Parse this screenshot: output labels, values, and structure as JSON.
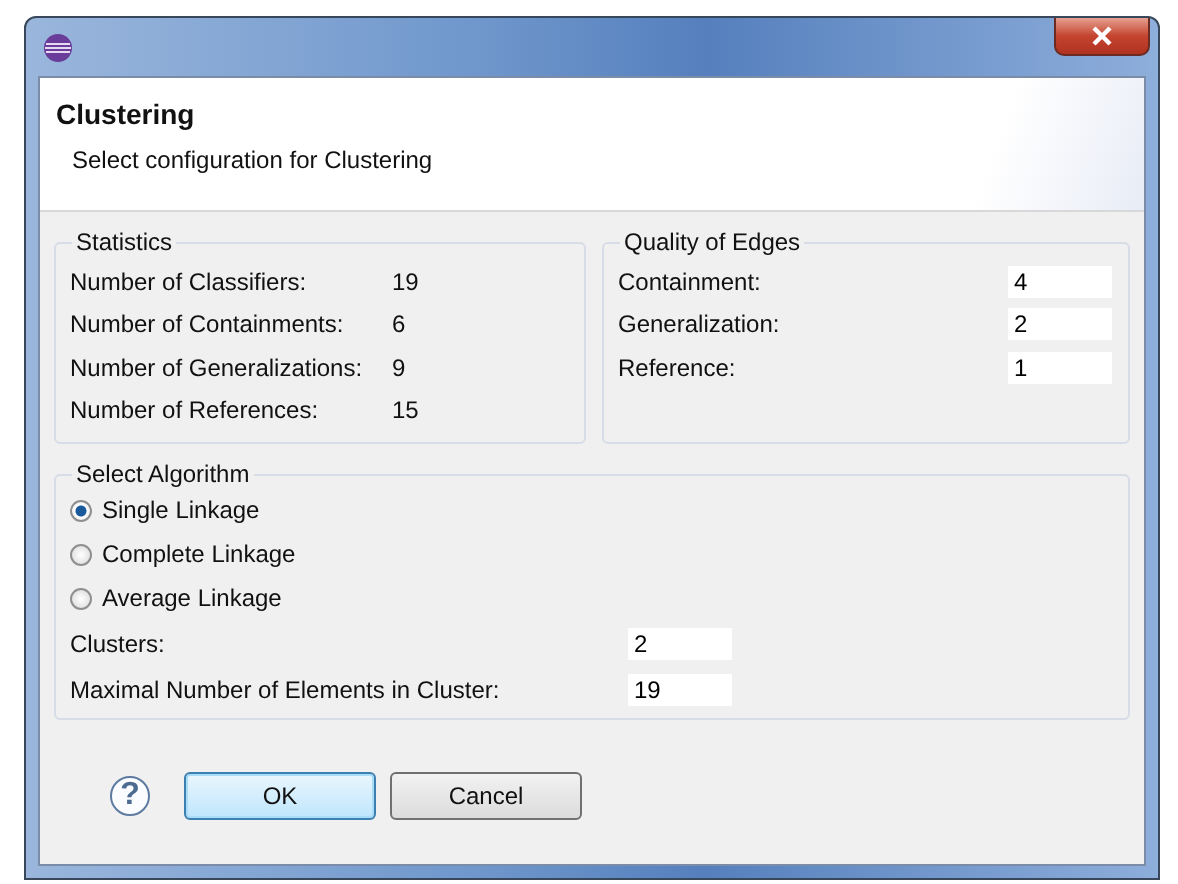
{
  "header": {
    "title": "Clustering",
    "description": "Select configuration for Clustering"
  },
  "statistics": {
    "title": "Statistics",
    "rows": [
      {
        "label": "Number of Classifiers:",
        "value": "19"
      },
      {
        "label": "Number of Containments:",
        "value": "6"
      },
      {
        "label": "Number of Generalizations:",
        "value": "9"
      },
      {
        "label": "Number of References:",
        "value": "15"
      }
    ]
  },
  "quality_of_edges": {
    "title": "Quality of Edges",
    "fields": [
      {
        "label": "Containment:",
        "value": "4"
      },
      {
        "label": "Generalization:",
        "value": "2"
      },
      {
        "label": "Reference:",
        "value": "1"
      }
    ]
  },
  "algorithm": {
    "title": "Select Algorithm",
    "options": [
      {
        "label": "Single Linkage",
        "selected": true
      },
      {
        "label": "Complete Linkage",
        "selected": false
      },
      {
        "label": "Average Linkage",
        "selected": false
      }
    ],
    "fields": [
      {
        "label": "Clusters:",
        "value": "2"
      },
      {
        "label": "Maximal Number of Elements in Cluster:",
        "value": "19"
      }
    ]
  },
  "help": "?",
  "buttons": [
    {
      "label": "OK",
      "default": true
    },
    {
      "label": "Cancel",
      "default": false
    }
  ]
}
